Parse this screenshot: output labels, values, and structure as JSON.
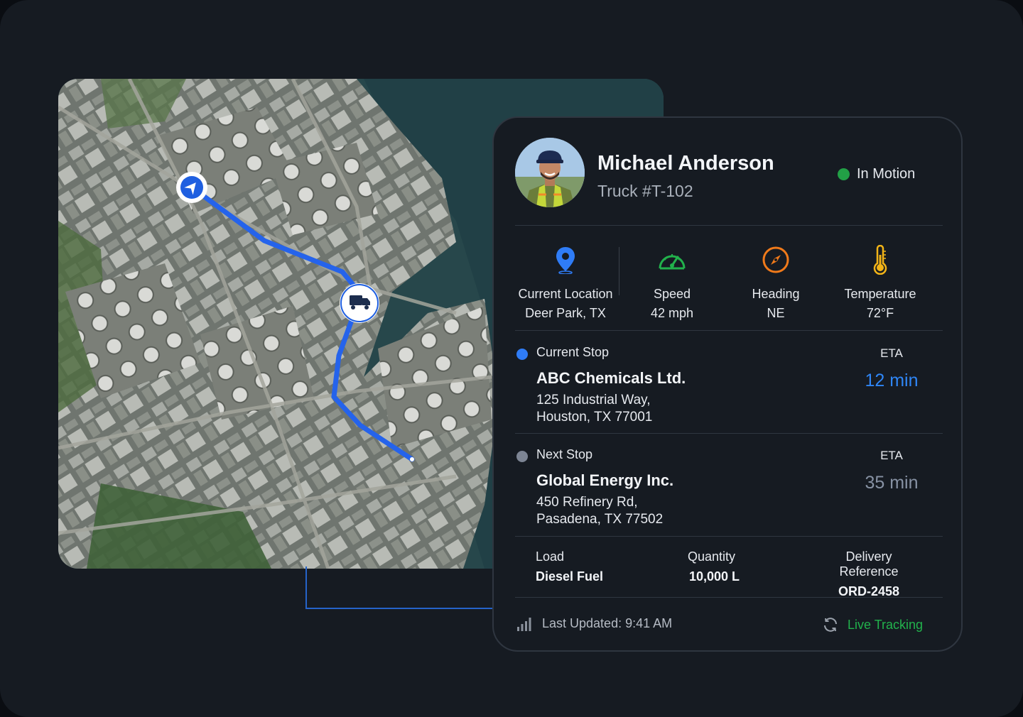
{
  "driver": {
    "name": "Michael Anderson",
    "truck": "Truck #T-102",
    "status": "In Motion",
    "status_color": "#22a046"
  },
  "metrics": [
    {
      "label": "Current Location",
      "value": "Deer Park, TX",
      "icon": "location-pin-icon",
      "color": "#2f7cf6"
    },
    {
      "label": "Speed",
      "value": "42 mph",
      "icon": "speedometer-icon",
      "color": "#22b24c"
    },
    {
      "label": "Heading",
      "value": "NE",
      "icon": "compass-icon",
      "color": "#f07a1a"
    },
    {
      "label": "Temperature",
      "value": "72°F",
      "icon": "thermometer-icon",
      "color": "#f2b417"
    }
  ],
  "current_stop": {
    "label": "Current Stop",
    "name": "ABC Chemicals Ltd.",
    "address_line1": "125 Industrial Way,",
    "address_line2": "Houston, TX 77001",
    "eta_label": "ETA",
    "eta": "12 min",
    "color": "#2f7cf6"
  },
  "next_stop": {
    "label": "Next Stop",
    "name": "Global Energy Inc.",
    "address_line1": "450 Refinery Rd,",
    "address_line2": "Pasadena, TX 77502",
    "eta_label": "ETA",
    "eta": "35 min",
    "color": "#7d8594"
  },
  "load": {
    "load_label": "Load",
    "load_value": "Diesel Fuel",
    "quantity_label": "Quantity",
    "quantity_value": "10,000 L",
    "reference_label": "Delivery Reference",
    "reference_value": "ORD-2458"
  },
  "footer": {
    "last_updated": "Last Updated: 9:41 AM",
    "live_tracking": "Live Tracking",
    "live_color": "#22b24c"
  },
  "map": {
    "route_color": "#2563eb",
    "origin_icon": "navigation-arrow-icon",
    "vehicle_icon": "truck-icon"
  }
}
